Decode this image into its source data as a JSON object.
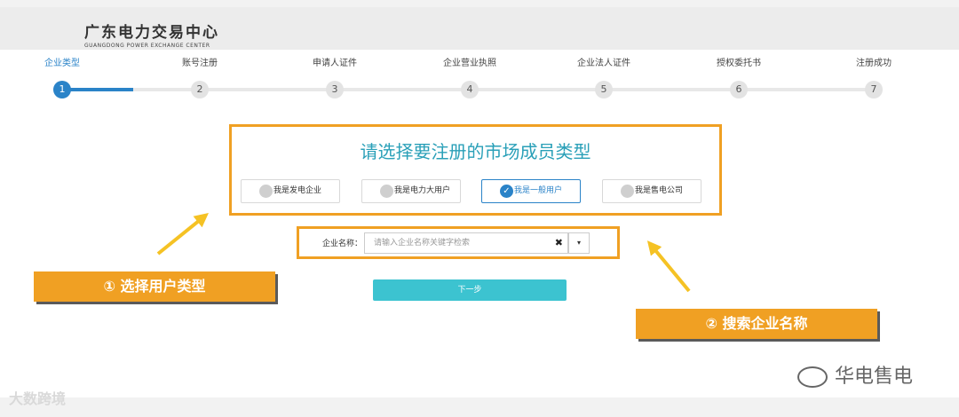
{
  "header": {
    "logo_cn": "广东电力交易中心",
    "logo_en": "GUANGDONG POWER EXCHANGE CENTER"
  },
  "steps": [
    {
      "label": "企业类型",
      "num": "1"
    },
    {
      "label": "账号注册",
      "num": "2"
    },
    {
      "label": "申请人证件",
      "num": "3"
    },
    {
      "label": "企业营业执照",
      "num": "4"
    },
    {
      "label": "企业法人证件",
      "num": "5"
    },
    {
      "label": "授权委托书",
      "num": "6"
    },
    {
      "label": "注册成功",
      "num": "7"
    }
  ],
  "current_step": 1,
  "member_type": {
    "title": "请选择要注册的市场成员类型",
    "options": [
      {
        "label": "我是发电企业",
        "selected": false
      },
      {
        "label": "我是电力大用户",
        "selected": false
      },
      {
        "label": "我是一般用户",
        "selected": true
      },
      {
        "label": "我是售电公司",
        "selected": false
      }
    ]
  },
  "search": {
    "label": "企业名称：",
    "placeholder": "请输入企业名称关键字检索",
    "clear_glyph": "✖",
    "dropdown_glyph": "▾"
  },
  "next_label": "下一步",
  "callouts": {
    "step1": "① 选择用户类型",
    "step2": "② 搜索企业名称"
  },
  "watermarks": {
    "left": "大数跨境",
    "right": "华电售电"
  },
  "colors": {
    "accent_blue": "#2a83c8",
    "highlight_orange": "#f0a023",
    "next_button": "#3cc3d0",
    "title_teal": "#2aa0b8"
  }
}
